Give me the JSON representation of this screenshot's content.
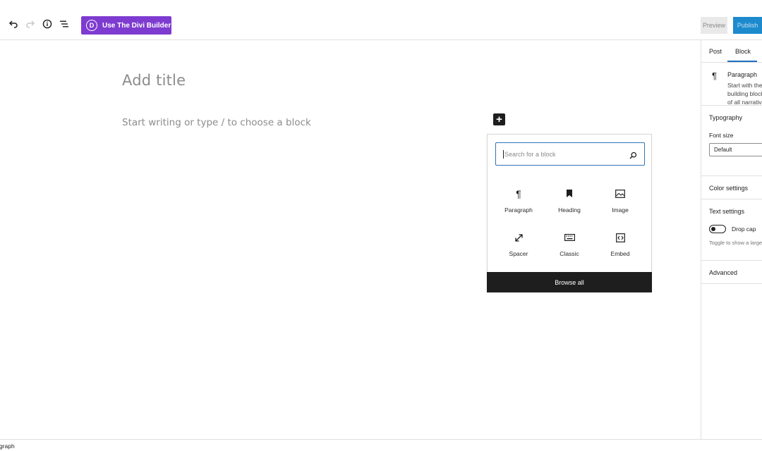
{
  "toolbar": {
    "undo_icon": "undo-icon",
    "redo_icon": "redo-icon",
    "info_icon": "info-icon",
    "list_view_icon": "list-view-icon",
    "divi_logo_letter": "D",
    "divi_button_label": "Use The Divi Builder",
    "preview_label": "Preview",
    "publish_label": "Publish",
    "colors": {
      "divi_purple": "#7e3bd0",
      "publish_blue": "#1d8acd"
    }
  },
  "editor": {
    "title_placeholder": "Add title",
    "body_placeholder": "Start writing or type / to choose a block",
    "inserter_toggle_glyph": "+"
  },
  "inserter": {
    "search_placeholder": "Search for a block",
    "blocks": [
      {
        "label": "Paragraph",
        "icon": "paragraph-icon"
      },
      {
        "label": "Heading",
        "icon": "bookmark-icon"
      },
      {
        "label": "Image",
        "icon": "image-icon"
      },
      {
        "label": "Spacer",
        "icon": "resize-arrows-icon"
      },
      {
        "label": "Classic",
        "icon": "keyboard-icon"
      },
      {
        "label": "Embed",
        "icon": "embed-code-icon"
      }
    ],
    "browse_all_label": "Browse all"
  },
  "sidebar": {
    "tabs": [
      "Post",
      "Block"
    ],
    "active_tab": "Block",
    "block_card": {
      "title": "Paragraph",
      "description": "Start with the building block of all narrative."
    },
    "typography": {
      "title": "Typography",
      "font_size_label": "Font size",
      "font_size_value": "Default"
    },
    "color_settings_title": "Color settings",
    "text_settings": {
      "title": "Text settings",
      "drop_cap_label": "Drop cap",
      "drop_cap_on": false,
      "drop_cap_help": "Toggle to show a large initial letter."
    },
    "advanced_title": "Advanced"
  },
  "footer": {
    "breadcrumb": "Paragraph"
  }
}
